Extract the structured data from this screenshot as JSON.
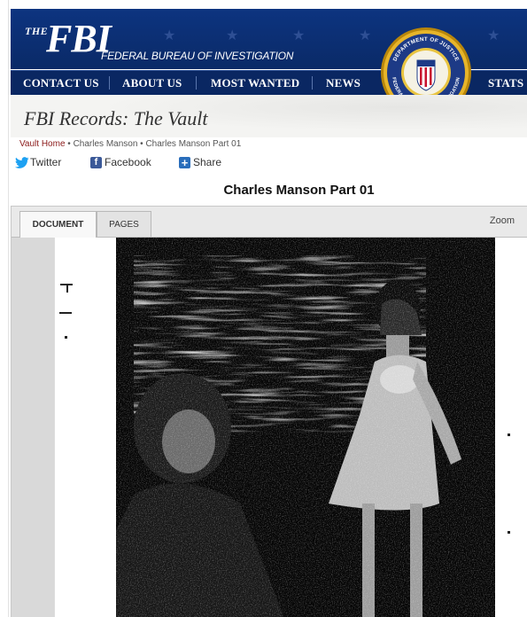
{
  "header": {
    "logo_the": "THE",
    "logo_fbi": "FBI",
    "logo_subtitle": "FEDERAL BUREAU OF INVESTIGATION",
    "seal_text_top": "DEPARTMENT OF JUSTICE",
    "seal_text_bottom": "FEDERAL BUREAU OF INVESTIGATION",
    "colors": {
      "header_blue": "#0b2c6e",
      "nav_blue": "#0a2762",
      "seal_gold": "#d9a520"
    }
  },
  "nav": {
    "items": [
      {
        "label": "CONTACT US"
      },
      {
        "label": "ABOUT US"
      },
      {
        "label": "MOST WANTED"
      },
      {
        "label": "NEWS"
      },
      {
        "label": "STATS &"
      }
    ]
  },
  "vault": {
    "title": "FBI Records: The Vault"
  },
  "breadcrumb": {
    "home": "Vault Home",
    "sep": " • ",
    "item1": "Charles Manson",
    "item2": "Charles Manson Part 01"
  },
  "share": {
    "twitter": "Twitter",
    "facebook": "Facebook",
    "share": "Share",
    "icons": {
      "twitter": "twitter-bird-icon",
      "facebook": "facebook-f-icon",
      "share": "plus-share-icon"
    },
    "colors": {
      "twitter": "#1da1f2",
      "facebook": "#3b5998",
      "share": "#2a6ebb"
    }
  },
  "document": {
    "title": "Charles Manson Part 01"
  },
  "viewer": {
    "tabs": [
      {
        "label": "DOCUMENT",
        "active": true
      },
      {
        "label": "PAGES",
        "active": false
      }
    ],
    "zoom_label": "Zoom"
  }
}
